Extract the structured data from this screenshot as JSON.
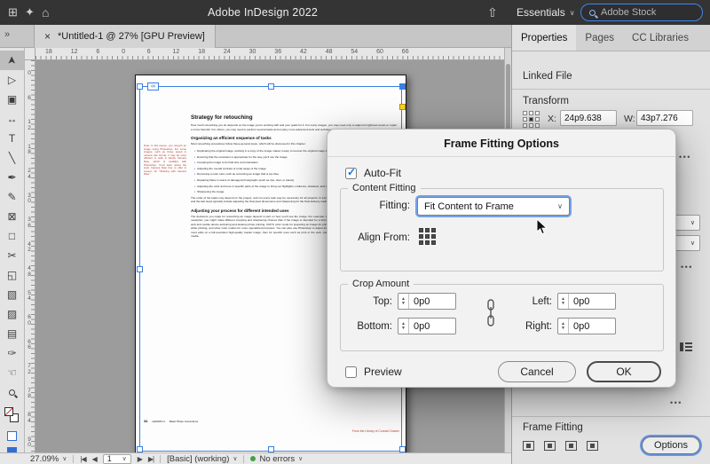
{
  "icons": {
    "close": "×",
    "chevron_down": "∨",
    "collapse": "»",
    "home": "⌂",
    "grid": "⊞",
    "sparkle": "✦",
    "share": "⇧",
    "more": "•••",
    "first_page": "|◀",
    "prev_page": "◀",
    "next_page": "▶",
    "last_page": "▶|",
    "infinity": "∞",
    "check": "✓",
    "step_up": "▲",
    "step_down": "▼"
  },
  "titlebar": {
    "title": "Adobe InDesign 2022",
    "workspace_label": "Essentials",
    "search_value": "Adobe Stock"
  },
  "tabbar": {
    "document_tab_label": "*Untitled-1 @ 27% [GPU Preview]"
  },
  "toolbar": {
    "tools": [
      {
        "name": "selection-tool",
        "glyph": "➤",
        "selected": true
      },
      {
        "name": "direct-selection-tool",
        "glyph": "▷"
      },
      {
        "name": "page-tool",
        "glyph": "▣"
      },
      {
        "name": "gap-tool",
        "glyph": "↔"
      },
      {
        "name": "type-tool",
        "glyph": "T"
      },
      {
        "name": "line-tool",
        "glyph": "╲"
      },
      {
        "name": "pen-tool",
        "glyph": "✒"
      },
      {
        "name": "pencil-tool",
        "glyph": "✎"
      },
      {
        "name": "rectangle-frame-tool",
        "glyph": "⊠"
      },
      {
        "name": "rectangle-tool",
        "glyph": "□"
      },
      {
        "name": "scissors-tool",
        "glyph": "✂"
      },
      {
        "name": "free-transform-tool",
        "glyph": "◱"
      },
      {
        "name": "gradient-swatch-tool",
        "glyph": "▧"
      },
      {
        "name": "gradient-feather-tool",
        "glyph": "▨"
      },
      {
        "name": "note-tool",
        "glyph": "▤"
      },
      {
        "name": "eyedropper-tool",
        "glyph": "✑"
      },
      {
        "name": "hand-tool",
        "glyph": "☜"
      },
      {
        "name": "zoom-tool",
        "glyph": "magnifier"
      }
    ]
  },
  "rulers": {
    "horizontal": [
      "18",
      "12",
      "6",
      "0",
      "6",
      "12",
      "18",
      "24",
      "30",
      "36",
      "42",
      "48",
      "54",
      "60",
      "66"
    ],
    "vertical": [
      "0",
      "6",
      "12",
      "18",
      "24",
      "30",
      "36",
      "42",
      "48",
      "54",
      "60",
      "66",
      "72",
      "78",
      "84",
      "90"
    ]
  },
  "page": {
    "note": "Note: In this lesson, you retouch an image using Photoshop. For some images, such as those saved in camera raw format, it may be more efficient to work in Adobe Camera Raw, which is installed with Photoshop. You'll learn about the tools Camera Raw has to offer in Lesson 12, \"Working with Camera Raw.\"",
    "blocks": [
      {
        "type": "h1",
        "text": "Strategy for retouching"
      },
      {
        "type": "p",
        "text": "How much retouching you do depends on the image you're working with and your goals for it. For many images, you may need only to adjust its lightness levels or repair a minor blemish. For others, you may need to perform several tasks and employ more advanced tools and techniques."
      },
      {
        "type": "h2",
        "text": "Organizing an efficient sequence of tasks"
      },
      {
        "type": "p",
        "text": "Most retouching procedures follow these general steps, which will be discussed in this chapter:"
      },
      {
        "type": "bullet",
        "text": "Duplicating the original image; working in a copy of the image makes it easy to recover the original image later if necessary"
      },
      {
        "type": "bullet",
        "text": "Ensuring that the resolution is appropriate for the way you'll use the image"
      },
      {
        "type": "bullet",
        "text": "Cropping the image to its final size and orientation"
      },
      {
        "type": "bullet",
        "text": "Adjusting the overall contrast or tonal range of the image"
      },
      {
        "type": "bullet",
        "text": "Removing a color cast, such as correcting an image that is too blue"
      },
      {
        "type": "bullet",
        "text": "Repairing flaws in scans of damaged photographs (such as rips, dust, or stains)"
      },
      {
        "type": "bullet",
        "text": "Adjusting the color and tone in specific parts of the image to bring out highlights, midtones, shadows, and desaturated colors"
      },
      {
        "type": "bullet",
        "text": "Sharpening the image"
      },
      {
        "type": "p",
        "text": "The order of the tasks may depend on the project, and not every task may be necessary for all projects. In a basic workflow, correcting tones and colors are early steps, and the last steps typically include adjusting the final pixel dimensions and sharpening for the final delivery medium."
      },
      {
        "type": "h2",
        "text": "Adjusting your process for different intended uses"
      },
      {
        "type": "p",
        "text": "The decisions you make for retouching an image depend in part on how you'll use the image. For example, if an image is intended for black-and-white publication on newsprint, you might make different cropping and sharpening choices than if the image is intended for a full-color web page. Photoshop supports RGB color mode for web and mobile device authoring and desktop photo printing, CMYK color mode for preparing an image for printing using process colors, Grayscale mode for black-and-white printing, and other color modes for more specialized purposes. You can also use Photoshop to adjust image pixel dimensions or resolution. In general, plan to do most edits on a full-resolution high-quality master image; then for specific uses such as print or the web, make copies adjusted to the requirements of each of those media."
      }
    ],
    "footer_page_number": "34",
    "footer_lesson": "LESSON 2",
    "footer_title": "Basic Photo Corrections",
    "watermark": "From the Library of Conrad Chavez"
  },
  "right_panel": {
    "tabs": [
      "Properties",
      "Pages",
      "CC Libraries"
    ],
    "linked_file_label": "Linked File",
    "transform": {
      "label": "Transform",
      "x_label": "X:",
      "x_value": "24p9.638",
      "w_label": "W:",
      "w_value": "43p7.276"
    },
    "frame_fitting": {
      "label": "Frame Fitting",
      "options_label": "Options"
    }
  },
  "dialog": {
    "title": "Frame Fitting Options",
    "auto_fit_label": "Auto-Fit",
    "content_fitting": {
      "label": "Content Fitting",
      "fitting_label": "Fitting:",
      "fitting_value": "Fit Content to Frame",
      "align_from_label": "Align From:"
    },
    "crop_amount": {
      "label": "Crop Amount",
      "top_label": "Top:",
      "top_value": "0p0",
      "bottom_label": "Bottom:",
      "bottom_value": "0p0",
      "left_label": "Left:",
      "left_value": "0p0",
      "right_label": "Right:",
      "right_value": "0p0"
    },
    "preview_label": "Preview",
    "cancel_label": "Cancel",
    "ok_label": "OK"
  },
  "statusbar": {
    "zoom_value": "27.09%",
    "page_value": "1",
    "preflight_profile": "[Basic] (working)",
    "preflight_status": "No errors"
  },
  "colors": {
    "accent_blue": "#1473e6",
    "selection_blue": "#3a7fe0",
    "handle_yellow": "#ffd21e",
    "status_green": "#43a047",
    "note_red": "#b03a2e"
  }
}
